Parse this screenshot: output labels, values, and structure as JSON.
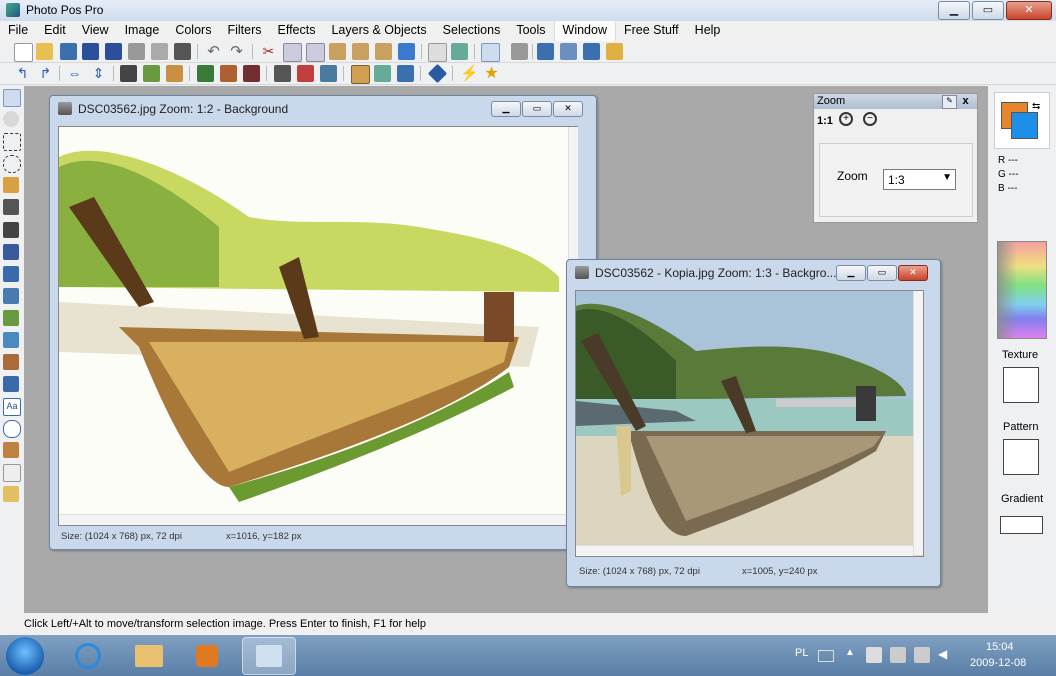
{
  "app": {
    "title": "Photo Pos Pro"
  },
  "window_controls": {
    "minimize": "▁",
    "maximize": "▭",
    "close": "✕"
  },
  "menu": [
    "File",
    "Edit",
    "View",
    "Image",
    "Colors",
    "Filters",
    "Effects",
    "Layers & Objects",
    "Selections",
    "Tools",
    "Window",
    "Free Stuff",
    "Help"
  ],
  "doc1": {
    "title": "DSC03562.jpg  Zoom: 1:2 - Background",
    "size": "Size: (1024 x 768) px, 72 dpi",
    "coords": "x=1016, y=182 px"
  },
  "doc2": {
    "title": "DSC03562 - Kopia.jpg  Zoom: 1:3 - Backgro...",
    "size": "Size: (1024 x 768) px, 72 dpi",
    "coords": "x=1005, y=240 px"
  },
  "zoom_panel": {
    "title": "Zoom",
    "close": "x",
    "one_to_one": "1:1",
    "label": "Zoom",
    "value": "1:3"
  },
  "color_panel": {
    "r": "R ---",
    "g": "G ---",
    "b": "B ---",
    "texture": "Texture",
    "pattern": "Pattern",
    "gradient": "Gradient",
    "fg_color": "#e8852a",
    "bg_color": "#1e8fe8"
  },
  "statusbar": {
    "text": "Click Left/+Alt to move/transform selection image. Press Enter to finish, F1 for help"
  },
  "taskbar": {
    "lang": "PL",
    "time": "15:04",
    "date": "2009-12-08"
  }
}
